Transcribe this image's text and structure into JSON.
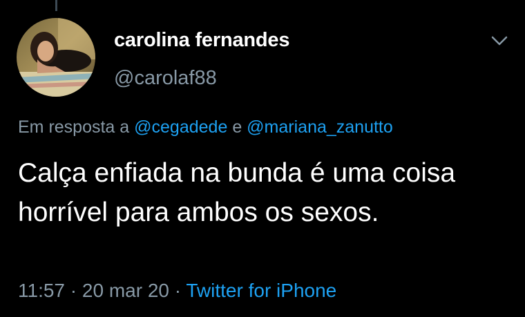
{
  "tweet": {
    "author": {
      "display_name": "carolina fernandes",
      "handle": "@carolaf88",
      "avatar": "profile-photo"
    },
    "reply_to": {
      "prefix": "Em resposta a",
      "mention_1": "@cegadede",
      "conjunction": "e",
      "mention_2": "@mariana_zanutto"
    },
    "text": "Calça enfiada na bunda é uma coisa horrível para ambos os sexos.",
    "time": "11:57",
    "separator": "·",
    "date": "20 mar 20",
    "source": "Twitter for iPhone",
    "menu_icon": "chevron-down-icon"
  },
  "colors": {
    "background": "#000000",
    "text_primary": "#ffffff",
    "text_secondary": "#8899a6",
    "accent": "#1da1f2",
    "thread_line": "#3d4a55"
  }
}
